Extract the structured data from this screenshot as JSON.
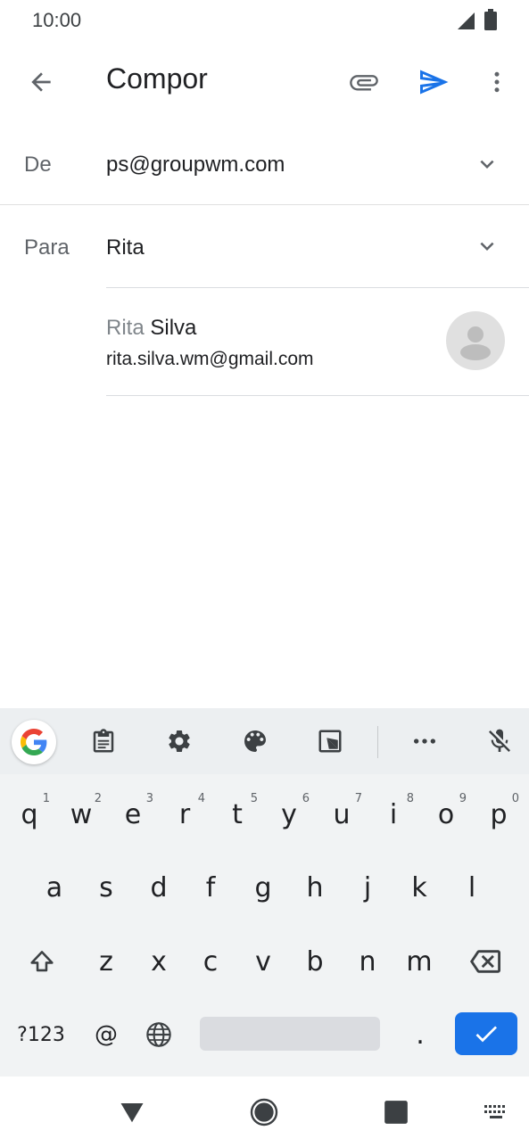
{
  "status": {
    "time": "10:00",
    "icons": [
      "signal-icon",
      "battery-icon"
    ]
  },
  "app_bar": {
    "title": "Compor",
    "icons": [
      "back-arrow-icon",
      "attach-icon",
      "send-icon",
      "more-vert-icon"
    ]
  },
  "from": {
    "label": "De",
    "value": "ps@groupwm.com"
  },
  "to": {
    "label": "Para",
    "value": "Rita"
  },
  "suggestion": {
    "name_match": "Rita",
    "name_rest": " Silva",
    "email": "rita.silva.wm@gmail.com"
  },
  "keyboard": {
    "row1": [
      {
        "key": "q",
        "hint": "1"
      },
      {
        "key": "w",
        "hint": "2"
      },
      {
        "key": "e",
        "hint": "3"
      },
      {
        "key": "r",
        "hint": "4"
      },
      {
        "key": "t",
        "hint": "5"
      },
      {
        "key": "y",
        "hint": "6"
      },
      {
        "key": "u",
        "hint": "7"
      },
      {
        "key": "i",
        "hint": "8"
      },
      {
        "key": "o",
        "hint": "9"
      },
      {
        "key": "p",
        "hint": "0"
      }
    ],
    "row2": [
      "a",
      "s",
      "d",
      "f",
      "g",
      "h",
      "j",
      "k",
      "l"
    ],
    "row3": [
      "z",
      "x",
      "c",
      "v",
      "b",
      "n",
      "m"
    ],
    "symbols_label": "?123",
    "at_label": "@",
    "period_label": ".",
    "accent_color": "#1a73e8"
  }
}
